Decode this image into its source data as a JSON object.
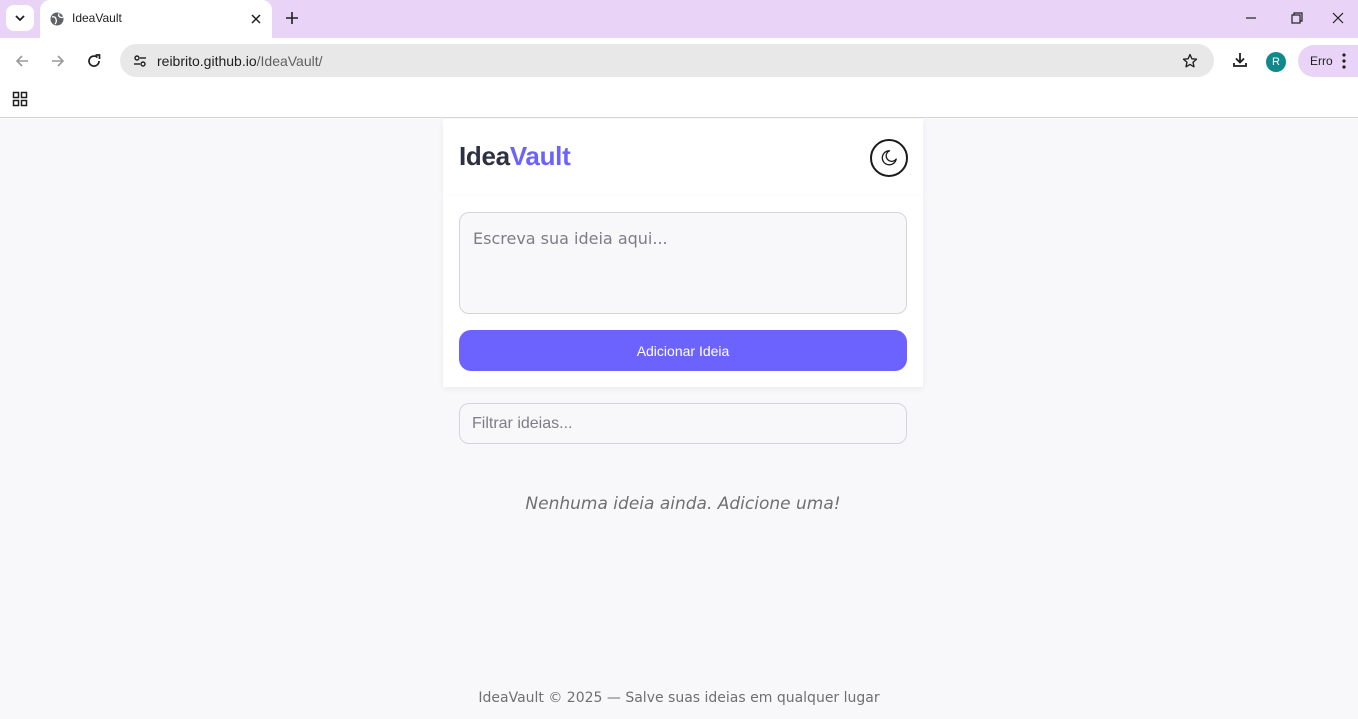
{
  "browser": {
    "tab_title": "IdeaVault",
    "url_host": "reibrito.github.io",
    "url_path": "/IdeaVault/",
    "profile_initial": "R",
    "error_label": "Erro",
    "accent_color": "#e9d4f7",
    "icons": [
      "tab-list-icon",
      "globe-icon",
      "close-icon",
      "plus-icon",
      "minimize-icon",
      "restore-icon",
      "back-icon",
      "forward-icon",
      "reload-icon",
      "site-info-icon",
      "star-icon",
      "download-icon",
      "kebab-icon",
      "apps-icon"
    ]
  },
  "app": {
    "logo_part1": "Idea",
    "logo_part2": "Vault",
    "brand_color": "#6c63ff",
    "theme_toggle_icon": "moon-icon",
    "idea_placeholder": "Escreva sua ideia aqui...",
    "idea_value": "",
    "add_button": "Adicionar Ideia",
    "filter_placeholder": "Filtrar ideias...",
    "filter_value": "",
    "empty_message": "Nenhuma ideia ainda. Adicione uma!",
    "footer": "IdeaVault © 2025 — Salve suas ideias em qualquer lugar"
  }
}
